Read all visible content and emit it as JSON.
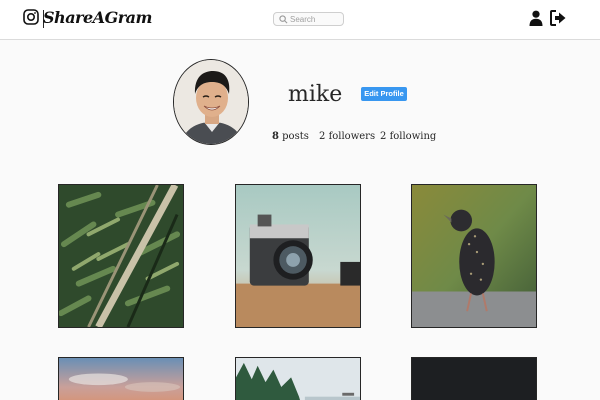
{
  "header": {
    "logo_text": "ShareAGram",
    "search_placeholder": "Search",
    "icons": [
      "instagram-icon",
      "search-icon",
      "user-icon",
      "logout-icon"
    ]
  },
  "profile": {
    "username": "mike",
    "edit_button_label": "Edit Profile",
    "posts_count": "8",
    "posts_label": "posts",
    "followers_count": "2",
    "followers_label": "followers",
    "following_count": "2",
    "following_label": "following"
  },
  "posts": [
    {
      "subject": "bamboo-leaves"
    },
    {
      "subject": "vintage-camera"
    },
    {
      "subject": "starling-bird"
    },
    {
      "subject": "sunset-sky"
    },
    {
      "subject": "forest-lake"
    },
    {
      "subject": "dark-photo"
    }
  ],
  "colors": {
    "accent": "#3897f0",
    "background": "#fafafa",
    "header_bg": "#ffffff",
    "border": "#dbdbdb"
  }
}
